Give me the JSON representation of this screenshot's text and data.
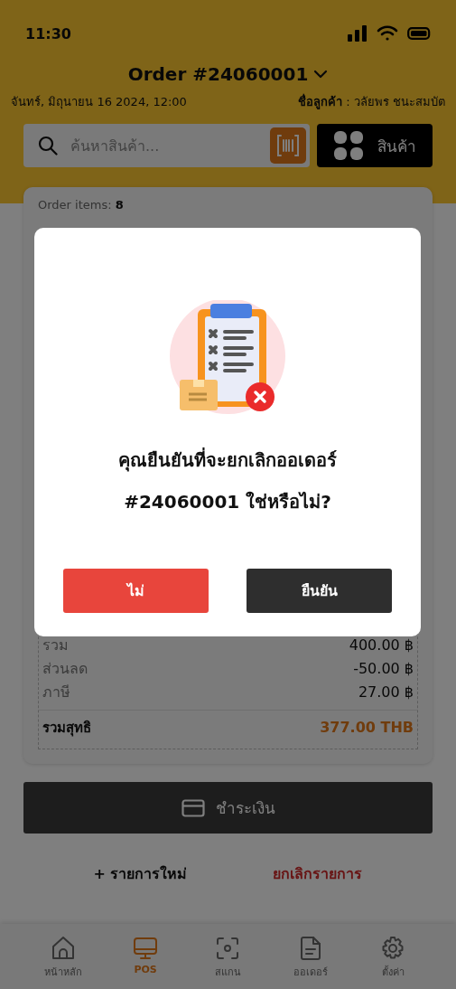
{
  "status_bar": {
    "time": "11:30"
  },
  "header": {
    "title": "Order #24060001",
    "date": "จันทร์, มิถุนายน 16 2024, 12:00",
    "customer": "**ชื่อลูกค้า** : วลัยพร ชนะสมบัต"
  },
  "search": {
    "placeholder": "ค้นหาสินค้า..."
  },
  "products_button": "สินค้า",
  "order": {
    "items": "Order items: **8**",
    "summary": [
      {
        "label": "รวม",
        "value": "400.00 ฿"
      },
      {
        "label": "ส่วนลด",
        "value": "-50.00 ฿"
      },
      {
        "label": "ภาษี",
        "value": "27.00 ฿"
      }
    ],
    "total": {
      "label": "รวมสุทธิ",
      "value": "377.00 THB"
    }
  },
  "pay_button": "ชำระเงิน",
  "actions": [
    {
      "kind": "add",
      "label": "+ รายการใหม่"
    },
    {
      "kind": "cancel",
      "label": "ยกเลิกรายการ"
    }
  ],
  "nav": [
    {
      "kind": "home",
      "label": "หน้าหลัก",
      "selected": false
    },
    {
      "kind": "pos",
      "label": "POS",
      "selected": true
    },
    {
      "kind": "scan",
      "label": "สแกน",
      "selected": false
    },
    {
      "kind": "orders",
      "label": "ออเดอร์",
      "selected": false
    },
    {
      "kind": "settings",
      "label": "ตั้งค่า",
      "selected": false
    }
  ],
  "dialog": {
    "message": "คุณยืนยันที่จะยกเลิกออเดอร์ #24060001 ใช่หรือไม่?",
    "buttons": [
      {
        "kind": "cancel",
        "label": "ไม่"
      },
      {
        "kind": "confirm",
        "label": "ยืนยัน"
      }
    ]
  }
}
